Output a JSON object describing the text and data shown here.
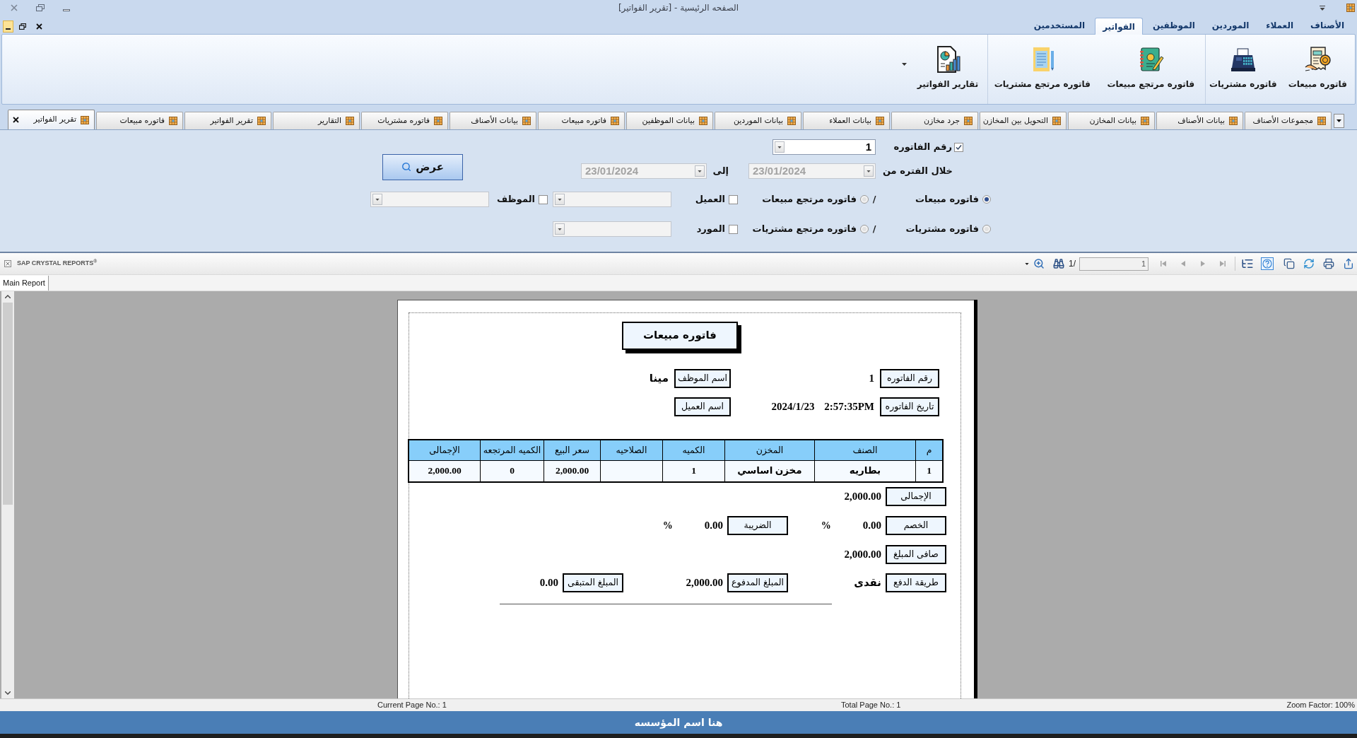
{
  "window": {
    "title": "الصفحه الرئيسية - [تقرير الفواتير]"
  },
  "ribbon": {
    "tabs": [
      {
        "label": "الأصناف",
        "selected": false
      },
      {
        "label": "العملاء",
        "selected": false
      },
      {
        "label": "الموردين",
        "selected": false
      },
      {
        "label": "الموظفين",
        "selected": false
      },
      {
        "label": "الفواتير",
        "selected": true
      },
      {
        "label": "المستخدمين",
        "selected": false
      }
    ],
    "groups": [
      {
        "buttons": [
          {
            "label": "فاتوره مبيعات"
          },
          {
            "label": "فاتوره مشتريات"
          }
        ]
      },
      {
        "buttons": [
          {
            "label": "فاتوره مرتجع مبيعات"
          },
          {
            "label": "فاتوره مرتجع مشتريات"
          }
        ]
      },
      {
        "buttons": [
          {
            "label": "تقارير الفواتير"
          }
        ]
      }
    ]
  },
  "document_tabs": [
    {
      "label": "مجموعات الأصناف",
      "selected": false
    },
    {
      "label": "بيانات الأصناف",
      "selected": false
    },
    {
      "label": "بيانات المخازن",
      "selected": false
    },
    {
      "label": "التحويل بين المخازن",
      "selected": false
    },
    {
      "label": "جرد مخازن",
      "selected": false
    },
    {
      "label": "بيانات العملاء",
      "selected": false
    },
    {
      "label": "بيانات الموردين",
      "selected": false
    },
    {
      "label": "بيانات الموظفين",
      "selected": false
    },
    {
      "label": "فاتوره مبيعات",
      "selected": false
    },
    {
      "label": "بيانات الأصناف",
      "selected": false
    },
    {
      "label": "فاتوره مشتريات",
      "selected": false
    },
    {
      "label": "التقارير",
      "selected": false
    },
    {
      "label": "تقرير الفواتير",
      "selected": false
    },
    {
      "label": "فاتوره مبيعات",
      "selected": false
    },
    {
      "label": "تقرير الفواتير",
      "selected": true
    }
  ],
  "filters": {
    "invoice_number": {
      "label": "رقم الفاتوره",
      "checked": true,
      "value": "1"
    },
    "period": {
      "label": "خلال الفتره من",
      "from": "23/01/2024",
      "to_label": "إلى",
      "to": "23/01/2024",
      "disabled": true
    },
    "show_button": {
      "label": "عرض"
    },
    "type_rows": [
      {
        "options": [
          {
            "label": "فاتوره مبيعات",
            "selected": true
          },
          {
            "label": "فاتوره مرتجع مبيعات",
            "selected": false
          }
        ],
        "separator": "/",
        "parties": [
          {
            "label": "العميل",
            "checked": false
          },
          {
            "label": "الموظف",
            "checked": false
          }
        ]
      },
      {
        "options": [
          {
            "label": "فاتوره مشتريات",
            "selected": false
          },
          {
            "label": "فاتوره مرتجع مشتريات",
            "selected": false
          }
        ],
        "separator": "/",
        "parties": [
          {
            "label": "المورد",
            "checked": false
          }
        ]
      }
    ]
  },
  "report_viewer": {
    "brand": "SAP CRYSTAL REPORTS$^{®}$",
    "page_count": "1/",
    "page_number": "1",
    "tabs": [
      {
        "label": "Main Report",
        "selected": true
      }
    ],
    "report": {
      "title": "فاتوره مبيعات",
      "info_rows": [
        {
          "fields": [
            {
              "label": "رقم الفاتوره",
              "value": "1"
            },
            {
              "label": "اسم الموظف",
              "value": "مينا"
            }
          ]
        },
        {
          "fields": [
            {
              "label": "تاريخ الفاتوره",
              "value": "2024/1/23 2:57:35PM"
            },
            {
              "label": "اسم العميل"
            }
          ]
        }
      ],
      "table": {
        "columns": [
          "م",
          "الصنف",
          "المخزن",
          "الكميه",
          "الصلاحيه",
          "سعر البيع",
          "الكميه المرتجعه",
          "الإجمالى"
        ],
        "rows": [
          [
            "1",
            "بطاريه",
            "مخزن اساسي",
            "1",
            null,
            "2,000.00",
            "0",
            "2,000.00"
          ]
        ]
      },
      "summary_rows": [
        {
          "fields": [
            {
              "label": "الإجمالى",
              "value": "2,000.00"
            }
          ]
        },
        {
          "fields": [
            {
              "label": "الخصم",
              "value": "0.00",
              "unit": "%"
            },
            {
              "label": "الضريبة",
              "value": "0.00",
              "unit": "%"
            }
          ]
        },
        {
          "fields": [
            {
              "label": "صافى المبلغ",
              "value": "2,000.00"
            }
          ]
        },
        {
          "fields": [
            {
              "label": "طريقة الدفع",
              "value": "نقدى"
            },
            {
              "label": "المبلغ المدفوع",
              "value": "2,000.00"
            },
            {
              "label": "المبلغ المتبقى",
              "value": "0.00"
            }
          ]
        }
      ]
    },
    "status_bar": {
      "current_page": "Current Page No.: 1",
      "total_pages": "Total Page No.: 1",
      "zoom": "Zoom Factor: 100%"
    }
  },
  "footer": {
    "text": "هنا اسم المؤسسه"
  }
}
